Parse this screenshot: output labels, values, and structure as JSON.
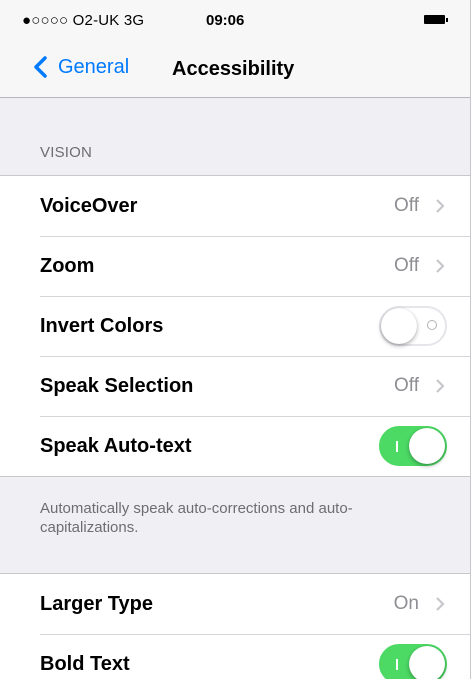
{
  "status_bar": {
    "carrier": "●○○○○ O2-UK  3G",
    "time": "09:06"
  },
  "nav": {
    "back_label": "General",
    "title": "Accessibility"
  },
  "vision": {
    "header": "VISION",
    "rows": [
      {
        "label": "VoiceOver",
        "value": "Off"
      },
      {
        "label": "Zoom",
        "value": "Off"
      },
      {
        "label": "Invert Colors",
        "toggle": "off"
      },
      {
        "label": "Speak Selection",
        "value": "Off"
      },
      {
        "label": "Speak Auto-text",
        "toggle": "on"
      }
    ],
    "footer": "Automatically speak auto-corrections and auto-capitalizations."
  },
  "text_group": {
    "rows": [
      {
        "label": "Larger Type",
        "value": "On"
      },
      {
        "label": "Bold Text",
        "toggle": "on"
      }
    ]
  },
  "colors": {
    "accent": "#007aff",
    "toggle_on": "#4cd964",
    "background": "#efeff4"
  }
}
